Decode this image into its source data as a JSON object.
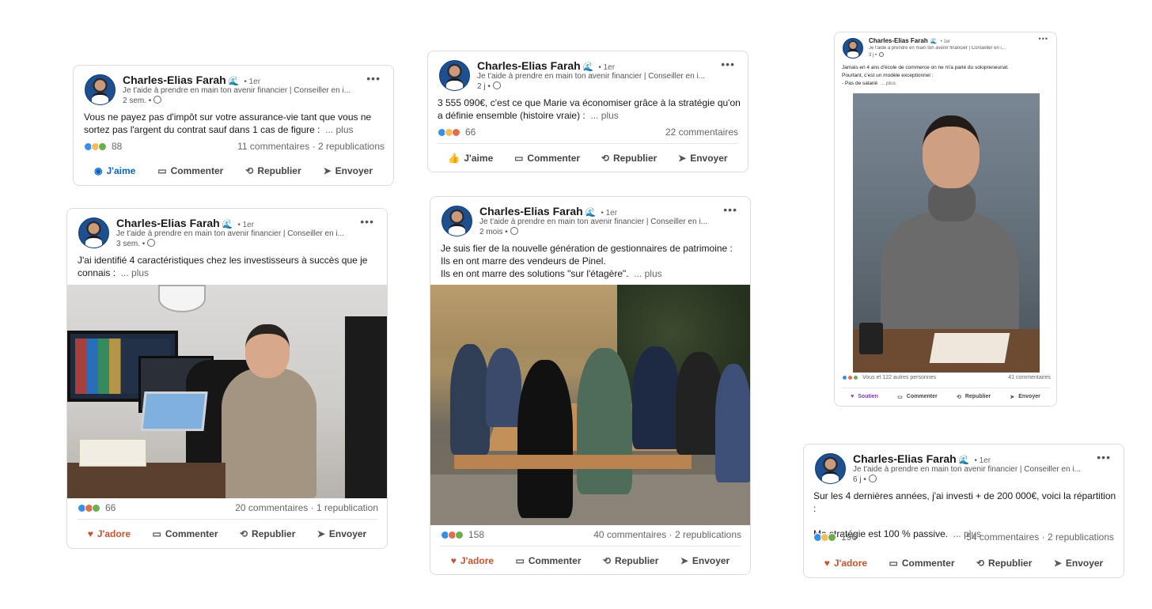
{
  "posts": [
    {
      "author": "Charles-Elias Farah",
      "badge": "🌊",
      "degree": "• 1er",
      "headline": "Je t'aide à prendre en main ton avenir financier | Conseiller en i...",
      "age": "2 sem. •",
      "text_lines": [
        "Vous ne payez pas d'impôt sur votre assurance-vie tant que vous ne",
        "sortez pas l'argent du contrat sauf dans 1 cas de figure :"
      ],
      "more": "... plus",
      "reactions": "88",
      "stats": "11 commentaires · 2 republications",
      "actions": {
        "react": "J'aime",
        "comment": "Commenter",
        "repost": "Republier",
        "send": "Envoyer"
      }
    },
    {
      "author": "Charles-Elias Farah",
      "badge": "🌊",
      "degree": "• 1er",
      "headline": "Je t'aide à prendre en main ton avenir financier | Conseiller en i...",
      "age": "2 j •",
      "text_lines": [
        "3 555 090€, c'est ce que Marie va économiser grâce à la stratégie qu'on",
        "a définie ensemble (histoire vraie) :"
      ],
      "more": "... plus",
      "reactions": "66",
      "stats": "22 commentaires",
      "actions": {
        "react": "J'aime",
        "comment": "Commenter",
        "repost": "Republier",
        "send": "Envoyer"
      }
    },
    {
      "author": "Charles-Elias Farah",
      "badge": "🌊",
      "degree": "• 1er",
      "headline": "Je t'aide à prendre en main ton avenir financier | Conseiller en i...",
      "age": "3 j •",
      "text_lines": [
        "Jamais en 4 ans d'école de commerce on ne m'a parlé du solopreneuriat.",
        "Pourtant, c'est un modèle exceptionnel :",
        "- Pas de salarié"
      ],
      "more": "... plus",
      "reactions": "Vous et 122 autres personnes",
      "stats": "41 commentaires",
      "actions": {
        "react": "Soutien",
        "comment": "Commenter",
        "repost": "Republier",
        "send": "Envoyer"
      }
    },
    {
      "author": "Charles-Elias Farah",
      "badge": "🌊",
      "degree": "• 1er",
      "headline": "Je t'aide à prendre en main ton avenir financier | Conseiller en i...",
      "age": "3 sem. •",
      "text_lines": [
        "J'ai identifié 4 caractéristiques chez les investisseurs à succès que je",
        "connais :"
      ],
      "more": "... plus",
      "reactions": "66",
      "stats": "20 commentaires · 1 republication",
      "actions": {
        "react": "J'adore",
        "comment": "Commenter",
        "repost": "Republier",
        "send": "Envoyer"
      }
    },
    {
      "author": "Charles-Elias Farah",
      "badge": "🌊",
      "degree": "• 1er",
      "headline": "Je t'aide à prendre en main ton avenir financier | Conseiller en i...",
      "age": "2 mois •",
      "text_lines": [
        "Je suis fier de la nouvelle génération de gestionnaires de patrimoine :",
        "Ils en ont marre des vendeurs de Pinel.",
        "Ils en ont marre des solutions \"sur l'étagère\"."
      ],
      "more": "... plus",
      "reactions": "158",
      "stats": "40 commentaires · 2 republications",
      "actions": {
        "react": "J'adore",
        "comment": "Commenter",
        "repost": "Republier",
        "send": "Envoyer"
      }
    },
    {
      "author": "Charles-Elias Farah",
      "badge": "🌊",
      "degree": "• 1er",
      "headline": "Je t'aide à prendre en main ton avenir financier | Conseiller en i...",
      "age": "6 j •",
      "text_lines": [
        "Sur les 4 dernières années, j'ai investi + de 200 000€, voici la répartition :",
        "",
        "Ma stratégie est 100 % passive."
      ],
      "more": "... plus",
      "reactions": "196",
      "stats": "54 commentaires · 2 republications",
      "actions": {
        "react": "J'adore",
        "comment": "Commenter",
        "repost": "Republier",
        "send": "Envoyer"
      }
    }
  ],
  "icons": {
    "menu": "•••",
    "comment": "comment-icon",
    "repost": "repost-icon",
    "send": "send-icon",
    "like": "thumb-icon"
  },
  "colors": {
    "like": "#0a66c2",
    "adore": "#c4532f",
    "support": "#7a3e9d"
  }
}
